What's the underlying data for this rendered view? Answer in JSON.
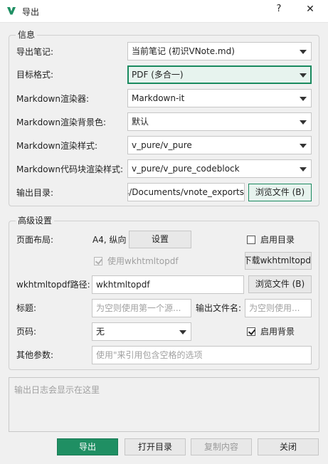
{
  "window": {
    "title": "导出",
    "help_label": "?",
    "close_label": "✕",
    "app_icon": "vnote-logo-icon",
    "accent_color": "#1f8f63"
  },
  "info": {
    "group_title": "信息",
    "source_note": {
      "label": "导出笔记:",
      "value": "当前笔记 (初识VNote.md)"
    },
    "target_format": {
      "label": "目标格式:",
      "value": "PDF (多合一)"
    },
    "renderer": {
      "label": "Markdown渲染器:",
      "value": "Markdown-it"
    },
    "render_bg": {
      "label": "Markdown渲染背景色:",
      "value": "默认"
    },
    "render_style": {
      "label": "Markdown渲染样式:",
      "value": "v_pure/v_pure"
    },
    "code_style": {
      "label": "Markdown代码块渲染样式:",
      "value": "v_pure/v_pure_codeblock"
    },
    "output_dir": {
      "label": "输出目录:",
      "value": "C:/Users/Documents/vnote_exports",
      "browse_label": "浏览文件 (B)"
    }
  },
  "advanced": {
    "group_title": "高级设置",
    "page_layout": {
      "label": "页面布局:",
      "value": "A4, 纵向",
      "settings_label": "设置"
    },
    "enable_toc": {
      "label": "启用目录",
      "checked": false
    },
    "use_wkhtmltopdf": {
      "label": "使用wkhtmltopdf",
      "checked": true
    },
    "download_wkhtmltopdf_label": "下载wkhtmltopd",
    "wk_path": {
      "label": "wkhtmltopdf路径:",
      "value": "wkhtmltopdf",
      "browse_label": "浏览文件 (B)"
    },
    "title": {
      "label": "标题:",
      "placeholder": "为空则使用第一个源..."
    },
    "output_filename": {
      "label": "输出文件名:",
      "placeholder": "为空则使用..."
    },
    "page_number": {
      "label": "页码:",
      "value": "无"
    },
    "enable_background": {
      "label": "启用背景",
      "checked": true
    },
    "extra_args": {
      "label": "其他参数:",
      "placeholder": "使用\"来引用包含空格的选项"
    }
  },
  "log": {
    "placeholder": "输出日志会显示在这里"
  },
  "footer": {
    "export_label": "导出",
    "open_dir_label": "打开目录",
    "copy_label": "复制内容",
    "close_label": "关闭"
  }
}
